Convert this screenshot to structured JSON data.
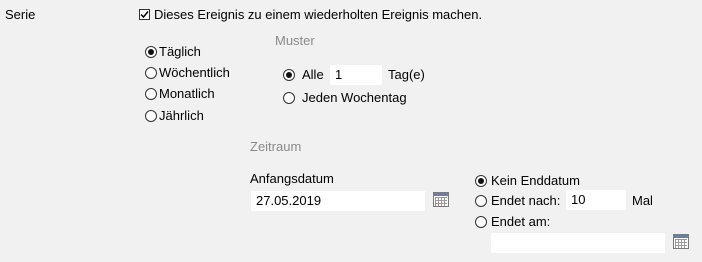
{
  "serie": {
    "label": "Serie",
    "repeat_checkbox_label": "Dieses Ereignis zu einem wiederholten Ereignis machen.",
    "repeat_checked": true
  },
  "frequency": {
    "options": [
      {
        "label": "Täglich",
        "selected": true
      },
      {
        "label": "Wöchentlich",
        "selected": false
      },
      {
        "label": "Monatlich",
        "selected": false
      },
      {
        "label": "Jährlich",
        "selected": false
      }
    ]
  },
  "pattern": {
    "heading": "Muster",
    "every_label": "Alle",
    "every_value": "1",
    "every_unit": "Tag(e)",
    "weekday_label": "Jeden Wochentag",
    "every_selected": true
  },
  "period": {
    "heading": "Zeitraum",
    "start_label": "Anfangsdatum",
    "start_value": "27.05.2019",
    "end_options": {
      "no_end": "Kein Enddatum",
      "after": "Endet nach:",
      "after_value": "10",
      "after_unit": "Mal",
      "on": "Endet am:",
      "on_value": ""
    },
    "end_selected": "no_end"
  },
  "icons": {
    "calendar": "calendar-icon",
    "checkmark": "checkmark-icon"
  }
}
